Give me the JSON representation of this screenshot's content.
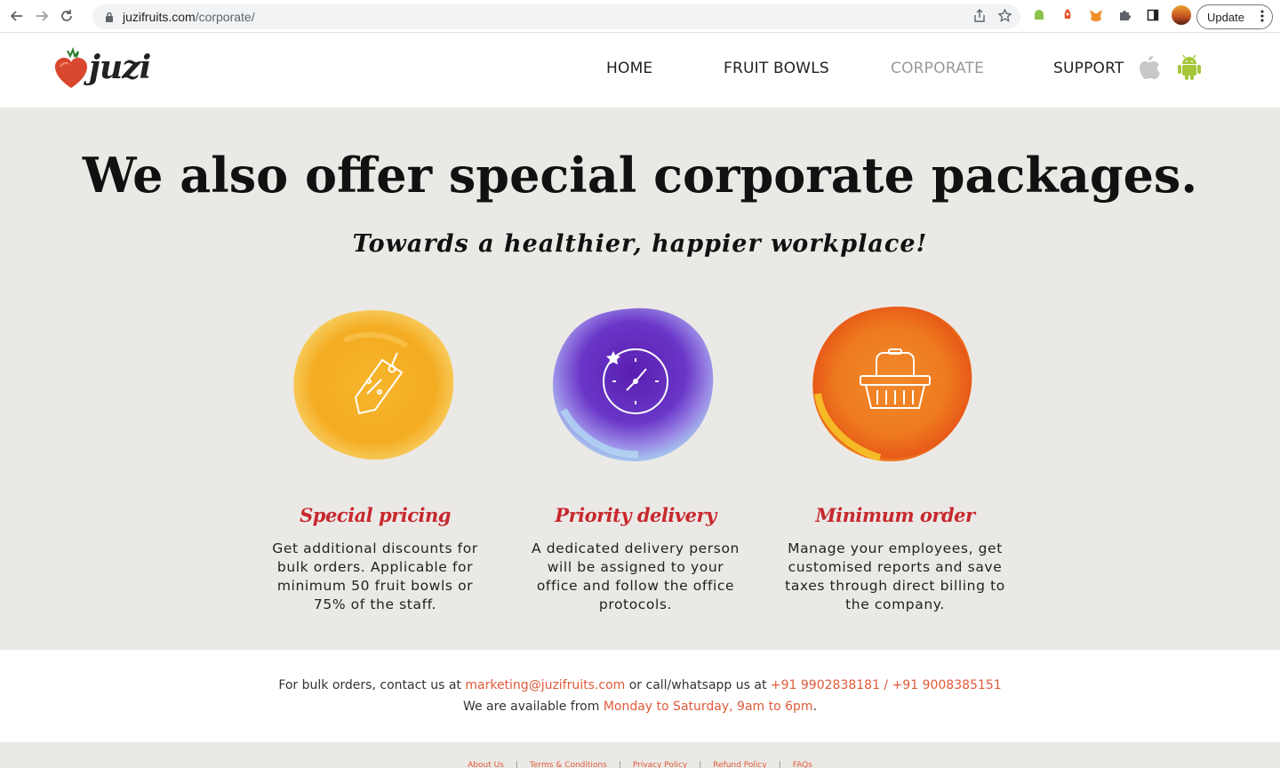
{
  "browser": {
    "url_host": "juzifruits.com",
    "url_path": "/corporate/",
    "update_label": "Update"
  },
  "site": {
    "logo_text": "juzi",
    "nav": {
      "home": "HOME",
      "fruit_bowls": "FRUIT BOWLS",
      "corporate": "CORPORATE",
      "support": "SUPPORT"
    }
  },
  "hero": {
    "title": "We also offer special corporate packages.",
    "subtitle": "Towards a healthier, happier workplace!"
  },
  "features": [
    {
      "title": "Special pricing",
      "text": "Get additional discounts for bulk orders. Applicable for minimum 50 fruit bowls or 75% of the staff.",
      "icon": "price-tag-icon"
    },
    {
      "title": "Priority delivery",
      "text": "A dedicated delivery person will be assigned to your office and follow the office protocols.",
      "icon": "clock-icon"
    },
    {
      "title": "Minimum order",
      "text": "Manage your employees, get customised reports and save taxes through direct billing to the company.",
      "icon": "basket-icon"
    }
  ],
  "contact": {
    "prefix": "For bulk orders, contact us at ",
    "email": "marketing@juzifruits.com",
    "middle": " or call/whatsapp us at ",
    "phones": "+91 9902838181 / +91 9008385151",
    "avail_prefix": "We are available from ",
    "hours": "Monday to Saturday, 9am to 6pm",
    "avail_suffix": "."
  },
  "footer": {
    "links": [
      "About Us",
      "Terms & Conditions",
      "Privacy Policy",
      "Refund Policy",
      "FAQs"
    ]
  },
  "colors": {
    "accent_red": "#c7282e",
    "link_orange": "#e05a3a",
    "hero_bg": "#ebe9e6"
  }
}
